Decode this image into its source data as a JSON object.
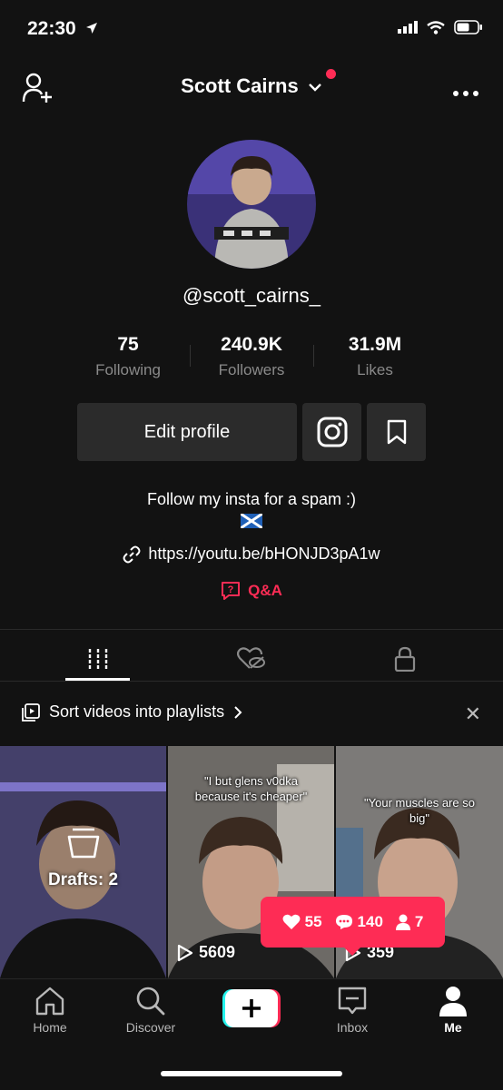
{
  "status_bar": {
    "time": "22:30"
  },
  "header": {
    "title": "Scott Cairns"
  },
  "profile": {
    "username": "@scott_cairns_",
    "stats": [
      {
        "value": "75",
        "label": "Following"
      },
      {
        "value": "240.9K",
        "label": "Followers"
      },
      {
        "value": "31.9M",
        "label": "Likes"
      }
    ],
    "edit_profile_label": "Edit profile",
    "bio_line1": "Follow my insta for a spam :)",
    "bio_flag": "🏴",
    "link": "https://youtu.be/bHONJD3pA1w",
    "qa_label": "Q&A"
  },
  "playlist_banner": {
    "text": "Sort videos into playlists"
  },
  "videos": {
    "drafts_label": "Drafts: 2",
    "video2_caption": "\"I but glens v0dka because it's cheaper\"",
    "video2_views": "5609",
    "video3_caption": "\"Your muscles are so big\"",
    "video3_views": "359"
  },
  "notification": {
    "likes": "55",
    "comments": "140",
    "followers": "7"
  },
  "tabbar": {
    "home": "Home",
    "discover": "Discover",
    "inbox": "Inbox",
    "me": "Me"
  },
  "colors": {
    "accent": "#fe2c55",
    "background": "#121212",
    "button": "#2b2b2b"
  }
}
